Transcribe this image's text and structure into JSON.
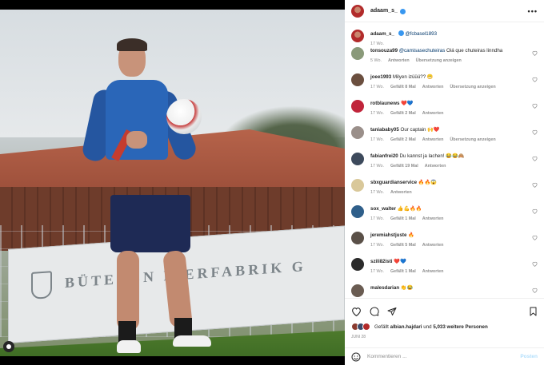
{
  "post": {
    "author": "adaam_s_",
    "caption_mention": "@fcbasel1893",
    "caption_time": "17 Wo.",
    "more_label": "•••"
  },
  "photo": {
    "banner_text": "BÜTENEN PIERFABRIK G"
  },
  "comments": [
    {
      "user": "tonsouza99",
      "mention": "@camisasechuteiras",
      "text": "Oiá que chuteiras linndha",
      "time": "5 Wo.",
      "likes": "",
      "reply": "Antworten",
      "translate": "Übersetzung anzeigen",
      "avatar_color": "#8a9a7a"
    },
    {
      "user": "joee1993",
      "mention": "",
      "text": "Milyen izüüü?? 😁",
      "time": "17 Wo.",
      "likes": "Gefällt 8 Mal",
      "reply": "Antworten",
      "translate": "Übersetzung anzeigen",
      "avatar_color": "#6b4f3f"
    },
    {
      "user": "rotblaunews",
      "mention": "",
      "text": "❤️💙",
      "time": "17 Wo.",
      "likes": "Gefällt 2 Mal",
      "reply": "Antworten",
      "translate": "",
      "avatar_color": "#c0243a"
    },
    {
      "user": "taniababy05",
      "mention": "",
      "text": "Our captain 🙌❤️",
      "time": "17 Wo.",
      "likes": "Gefällt 2 Mal",
      "reply": "Antworten",
      "translate": "Übersetzung anzeigen",
      "avatar_color": "#9a8f8a"
    },
    {
      "user": "fabianfrei20",
      "mention": "",
      "text": "Du kannst ja lachen! 😂😂🙈",
      "time": "17 Wo.",
      "likes": "Gefällt 19 Mal",
      "reply": "Antworten",
      "translate": "",
      "avatar_color": "#3d4a5c"
    },
    {
      "user": "sbxguardianservice",
      "mention": "",
      "text": "🔥🔥😱",
      "time": "17 Wo.",
      "likes": "",
      "reply": "Antworten",
      "translate": "",
      "avatar_color": "#d9c89a"
    },
    {
      "user": "sox_walter",
      "mention": "",
      "text": "👍💪🔥🔥",
      "time": "17 Wo.",
      "likes": "Gefällt 1 Mal",
      "reply": "Antworten",
      "translate": "",
      "avatar_color": "#2f5f8a"
    },
    {
      "user": "jeremiahstjuste",
      "mention": "",
      "text": "🔥",
      "time": "17 Wo.",
      "likes": "Gefällt 5 Mal",
      "reply": "Antworten",
      "translate": "",
      "avatar_color": "#5a5048"
    },
    {
      "user": "szili82isti",
      "mention": "",
      "text": "❤️💙",
      "time": "17 Wo.",
      "likes": "Gefällt 1 Mal",
      "reply": "Antworten",
      "translate": "",
      "avatar_color": "#2b2b2b"
    },
    {
      "user": "malesdarian",
      "mention": "",
      "text": "👏😂",
      "time": "",
      "likes": "",
      "reply": "",
      "translate": "",
      "avatar_color": "#6a5c52"
    }
  ],
  "footer": {
    "liked_prefix": "Gefällt",
    "liked_user": "albian.hajdari",
    "liked_and": "und",
    "liked_count": "5,033 weitere Personen",
    "date": "JUNI 28",
    "comment_placeholder": "Kommentieren ...",
    "post_label": "Posten"
  },
  "colors": {
    "verified": "#3897f0",
    "mention": "#00376b",
    "post_button_disabled": "#b2dffc"
  }
}
